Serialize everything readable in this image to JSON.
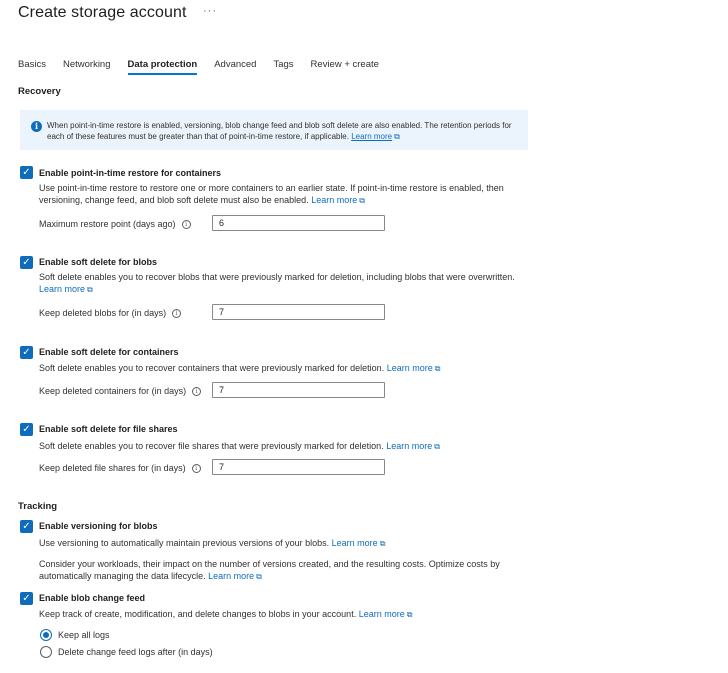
{
  "header": {
    "title": "Create storage account",
    "more": "···"
  },
  "tabs": [
    {
      "label": "Basics"
    },
    {
      "label": "Networking"
    },
    {
      "label": "Data protection"
    },
    {
      "label": "Advanced"
    },
    {
      "label": "Tags"
    },
    {
      "label": "Review + create"
    }
  ],
  "recovery": {
    "heading": "Recovery",
    "info": {
      "text": "When point-in-time restore is enabled, versioning, blob change feed and blob soft delete are also enabled. The retention periods for each of these features must be greater than that of point-in-time restore, if applicable.",
      "link": "Learn more"
    },
    "pitr": {
      "label": "Enable point-in-time restore for containers",
      "desc": "Use point-in-time restore to restore one or more containers to an earlier state. If point-in-time restore is enabled, then versioning, change feed, and blob soft delete must also be enabled.",
      "link": "Learn more",
      "field_label": "Maximum restore point (days ago)",
      "value": "6"
    },
    "blob_soft_delete": {
      "label": "Enable soft delete for blobs",
      "desc": "Soft delete enables you to recover blobs that were previously marked for deletion, including blobs that were overwritten.",
      "link": "Learn more",
      "field_label": "Keep deleted blobs for (in days)",
      "value": "7"
    },
    "container_soft_delete": {
      "label": "Enable soft delete for containers",
      "desc": "Soft delete enables you to recover containers that were previously marked for deletion.",
      "link": "Learn more",
      "field_label": "Keep deleted containers for (in days)",
      "value": "7"
    },
    "share_soft_delete": {
      "label": "Enable soft delete for file shares",
      "desc": "Soft delete enables you to recover file shares that were previously marked for deletion.",
      "link": "Learn more",
      "field_label": "Keep deleted file shares for (in days)",
      "value": "7"
    }
  },
  "tracking": {
    "heading": "Tracking",
    "versioning": {
      "label": "Enable versioning for blobs",
      "desc": "Use versioning to automatically maintain previous versions of your blobs.",
      "link": "Learn more",
      "desc2": "Consider your workloads, their impact on the number of versions created, and the resulting costs. Optimize costs by automatically managing the data lifecycle.",
      "link2": "Learn more"
    },
    "change_feed": {
      "label": "Enable blob change feed",
      "desc": "Keep track of create, modification, and delete changes to blobs in your account.",
      "link": "Learn more",
      "options": [
        {
          "label": "Keep all logs",
          "selected": true
        },
        {
          "label": "Delete change feed logs after (in days)",
          "selected": false
        }
      ]
    }
  },
  "colors": {
    "accent": "#0f6cbd",
    "info_bg": "#ebf3fc"
  }
}
